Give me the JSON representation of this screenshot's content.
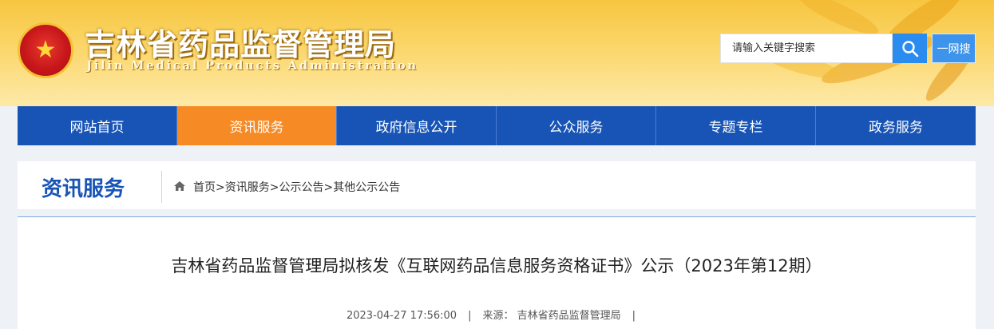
{
  "header": {
    "title_cn": "吉林省药品监督管理局",
    "title_en": "Jilin Medical Products Administration",
    "emblem_icon": "national-emblem-icon"
  },
  "search": {
    "placeholder": "请输入关键字搜索",
    "button_icon": "search-icon",
    "one_web_label": "一网搜"
  },
  "nav": {
    "items": [
      {
        "label": "网站首页"
      },
      {
        "label": "资讯服务"
      },
      {
        "label": "政府信息公开"
      },
      {
        "label": "公众服务"
      },
      {
        "label": "专题专栏"
      },
      {
        "label": "政务服务"
      }
    ],
    "active_index": 1
  },
  "section": {
    "title": "资讯服务"
  },
  "breadcrumb": {
    "home_icon": "home-icon",
    "text": "首页>资讯服务>公示公告>其他公示公告"
  },
  "article": {
    "title": "吉林省药品监督管理局拟核发《互联网药品信息服务资格证书》公示（2023年第12期）",
    "date": "2023-04-27 17:56:00",
    "source_label": "来源：",
    "source_value": "吉林省药品监督管理局"
  },
  "colors": {
    "nav_bg": "#1854b5",
    "nav_active": "#f68b26",
    "accent_blue": "#1854b5",
    "search_btn": "#2b8cef"
  }
}
